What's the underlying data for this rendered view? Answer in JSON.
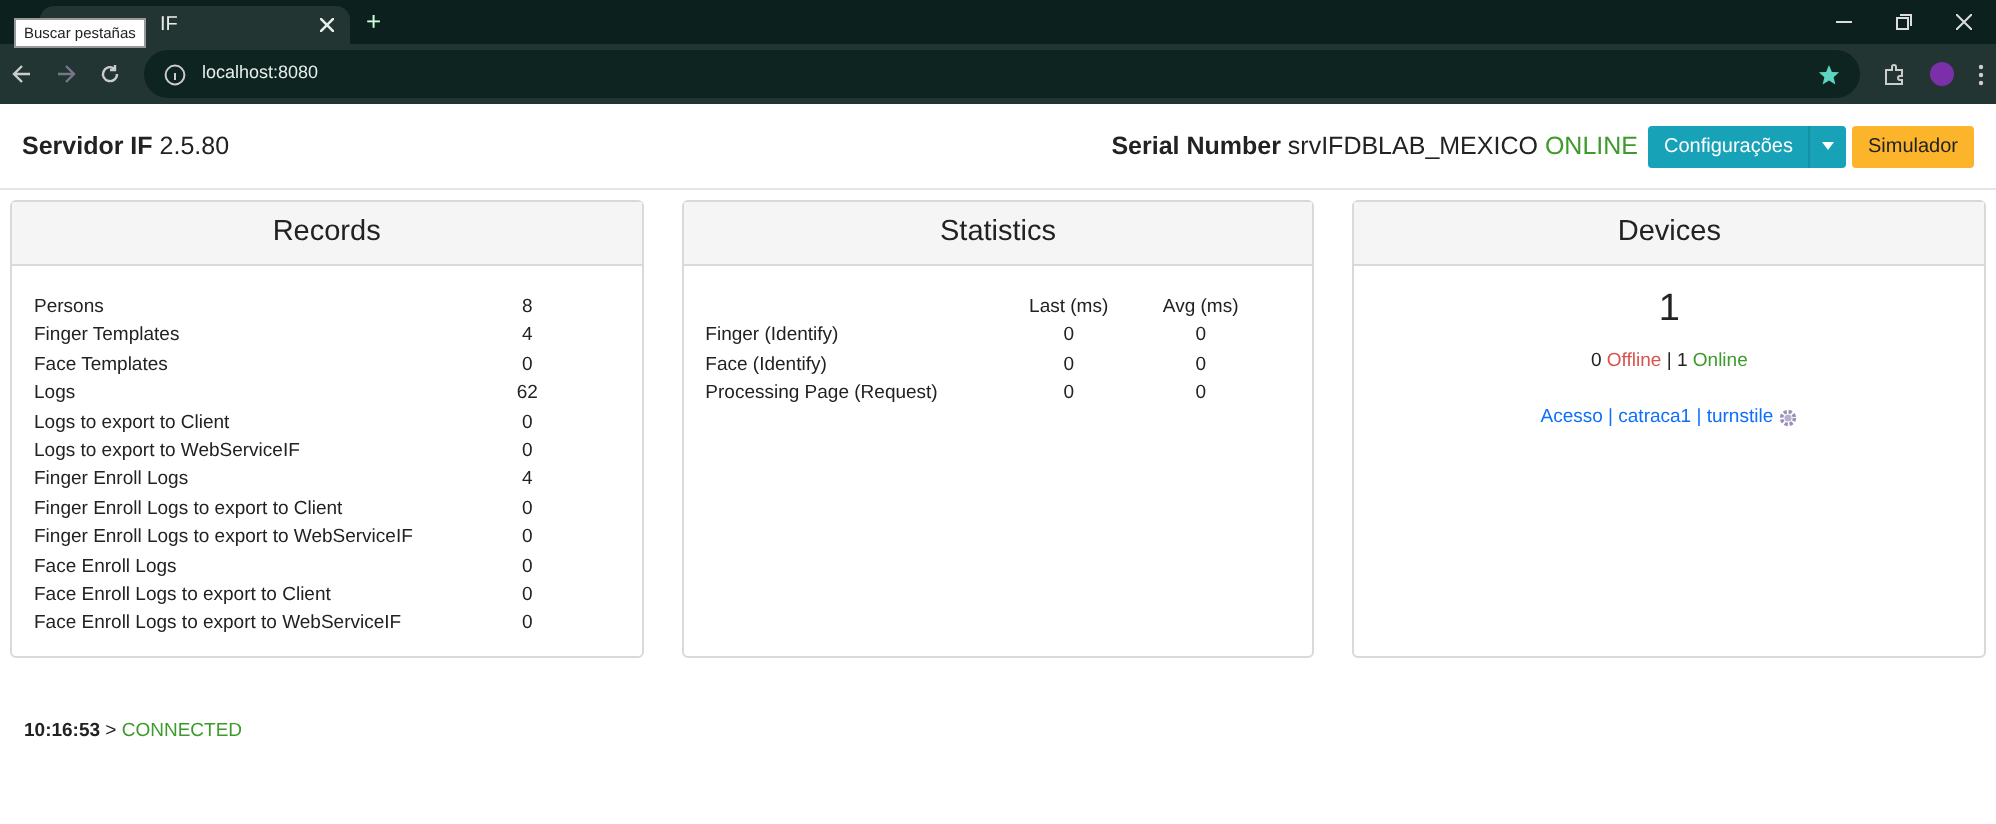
{
  "browser": {
    "tab_title": "IF",
    "tooltip": "Buscar pestañas",
    "new_tab": "+",
    "url": "localhost:8080"
  },
  "header": {
    "app_name": "Servidor IF",
    "version": "2.5.80",
    "serial_label": "Serial Number",
    "serial": "srvIFDBLAB_MEXICO",
    "status": "ONLINE",
    "buttons": [
      {
        "label": "Configurações",
        "kind": "split"
      },
      {
        "label": "Simulador",
        "kind": "plain"
      }
    ]
  },
  "records": {
    "title": "Records",
    "rows": [
      {
        "label": "Persons",
        "value": "8"
      },
      {
        "label": "Finger Templates",
        "value": "4"
      },
      {
        "label": "Face Templates",
        "value": "0"
      },
      {
        "label": "Logs",
        "value": "62"
      },
      {
        "label": "Logs to export to Client",
        "value": "0"
      },
      {
        "label": "Logs to export to WebServiceIF",
        "value": "0"
      },
      {
        "label": "Finger Enroll Logs",
        "value": "4"
      },
      {
        "label": "Finger Enroll Logs to export to Client",
        "value": "0"
      },
      {
        "label": "Finger Enroll Logs to export to WebServiceIF",
        "value": "0"
      },
      {
        "label": "Face Enroll Logs",
        "value": "0"
      },
      {
        "label": "Face Enroll Logs to export to Client",
        "value": "0"
      },
      {
        "label": "Face Enroll Logs to export to WebServiceIF",
        "value": "0"
      }
    ]
  },
  "statistics": {
    "title": "Statistics",
    "columns": [
      "Last (ms)",
      "Avg (ms)"
    ],
    "rows": [
      {
        "label": "Finger (Identify)",
        "last": "0",
        "avg": "0"
      },
      {
        "label": "Face (Identify)",
        "last": "0",
        "avg": "0"
      },
      {
        "label": "Processing Page (Request)",
        "last": "0",
        "avg": "0"
      }
    ]
  },
  "devices": {
    "title": "Devices",
    "count": "1",
    "offline_count": "0",
    "offline_label": "Offline",
    "separator": "|",
    "online_count": "1",
    "online_label": "Online",
    "device_link": "Acesso | catraca1 | turnstile"
  },
  "log": {
    "time": "10:16:53",
    "arrow": ">",
    "status": "CONNECTED"
  }
}
